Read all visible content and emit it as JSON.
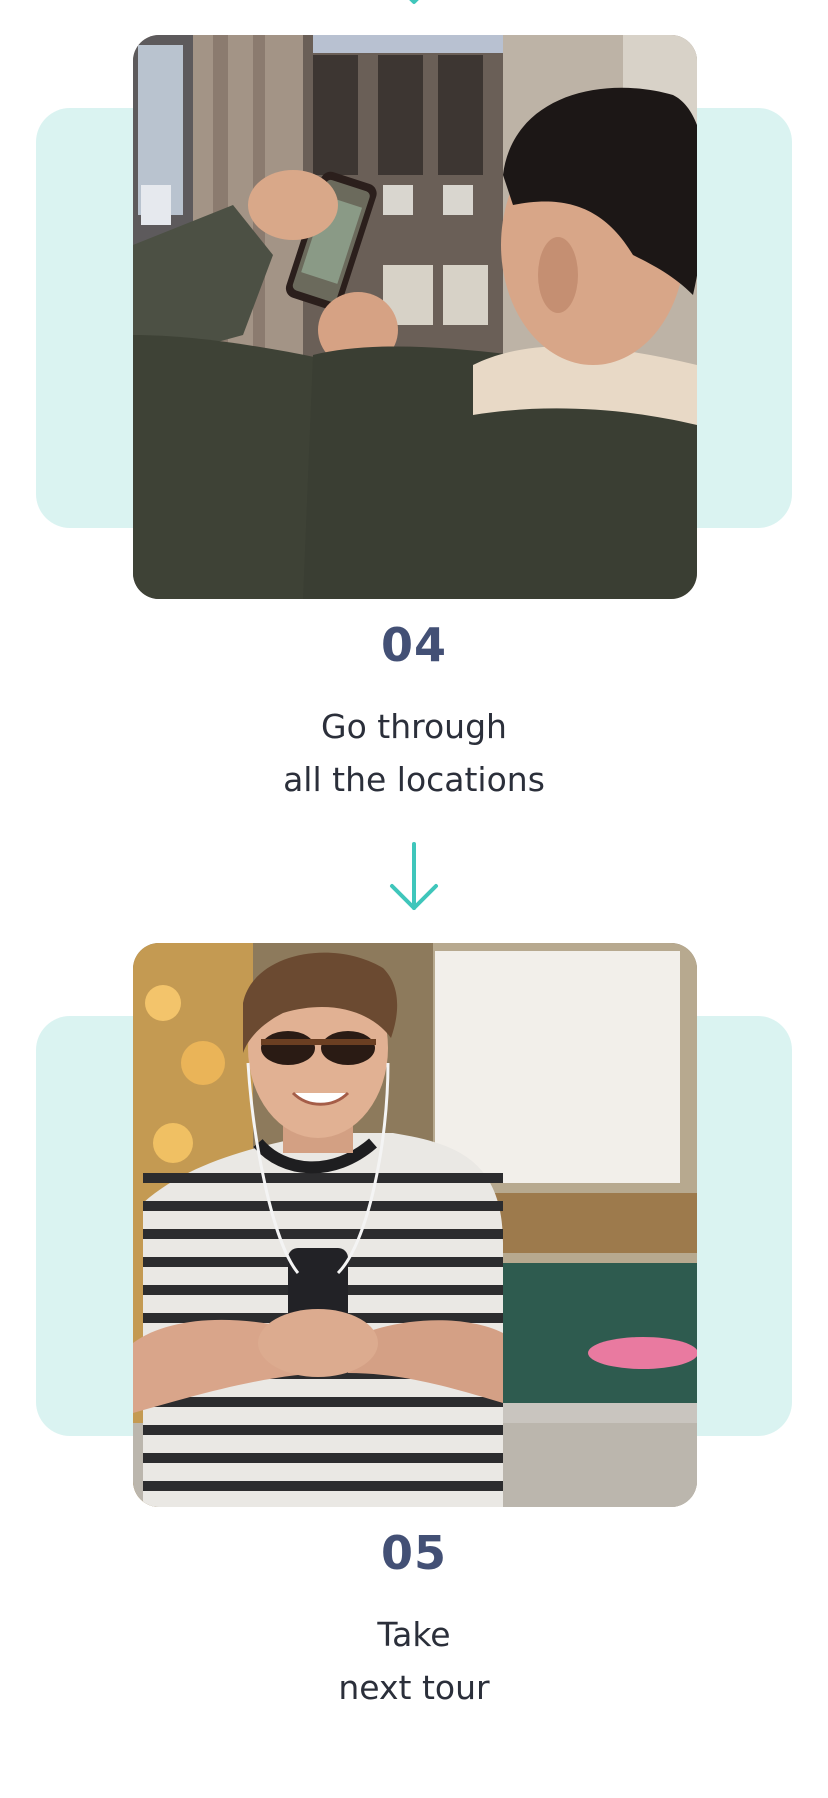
{
  "colors": {
    "accent": "#3fc6bb",
    "teal_background": "#daf3f1",
    "step_number": "#435075",
    "body_text": "#2b2f3a"
  },
  "steps": [
    {
      "number": "04",
      "line1": "Go through",
      "line2": "all the locations",
      "image": "man-photographing-building-with-phone"
    },
    {
      "number": "05",
      "line1": "Take",
      "line2": "next tour",
      "image": "smiling-man-with-sunglasses-holding-phone"
    }
  ],
  "icons": {
    "arrow": "arrow-down-icon"
  }
}
